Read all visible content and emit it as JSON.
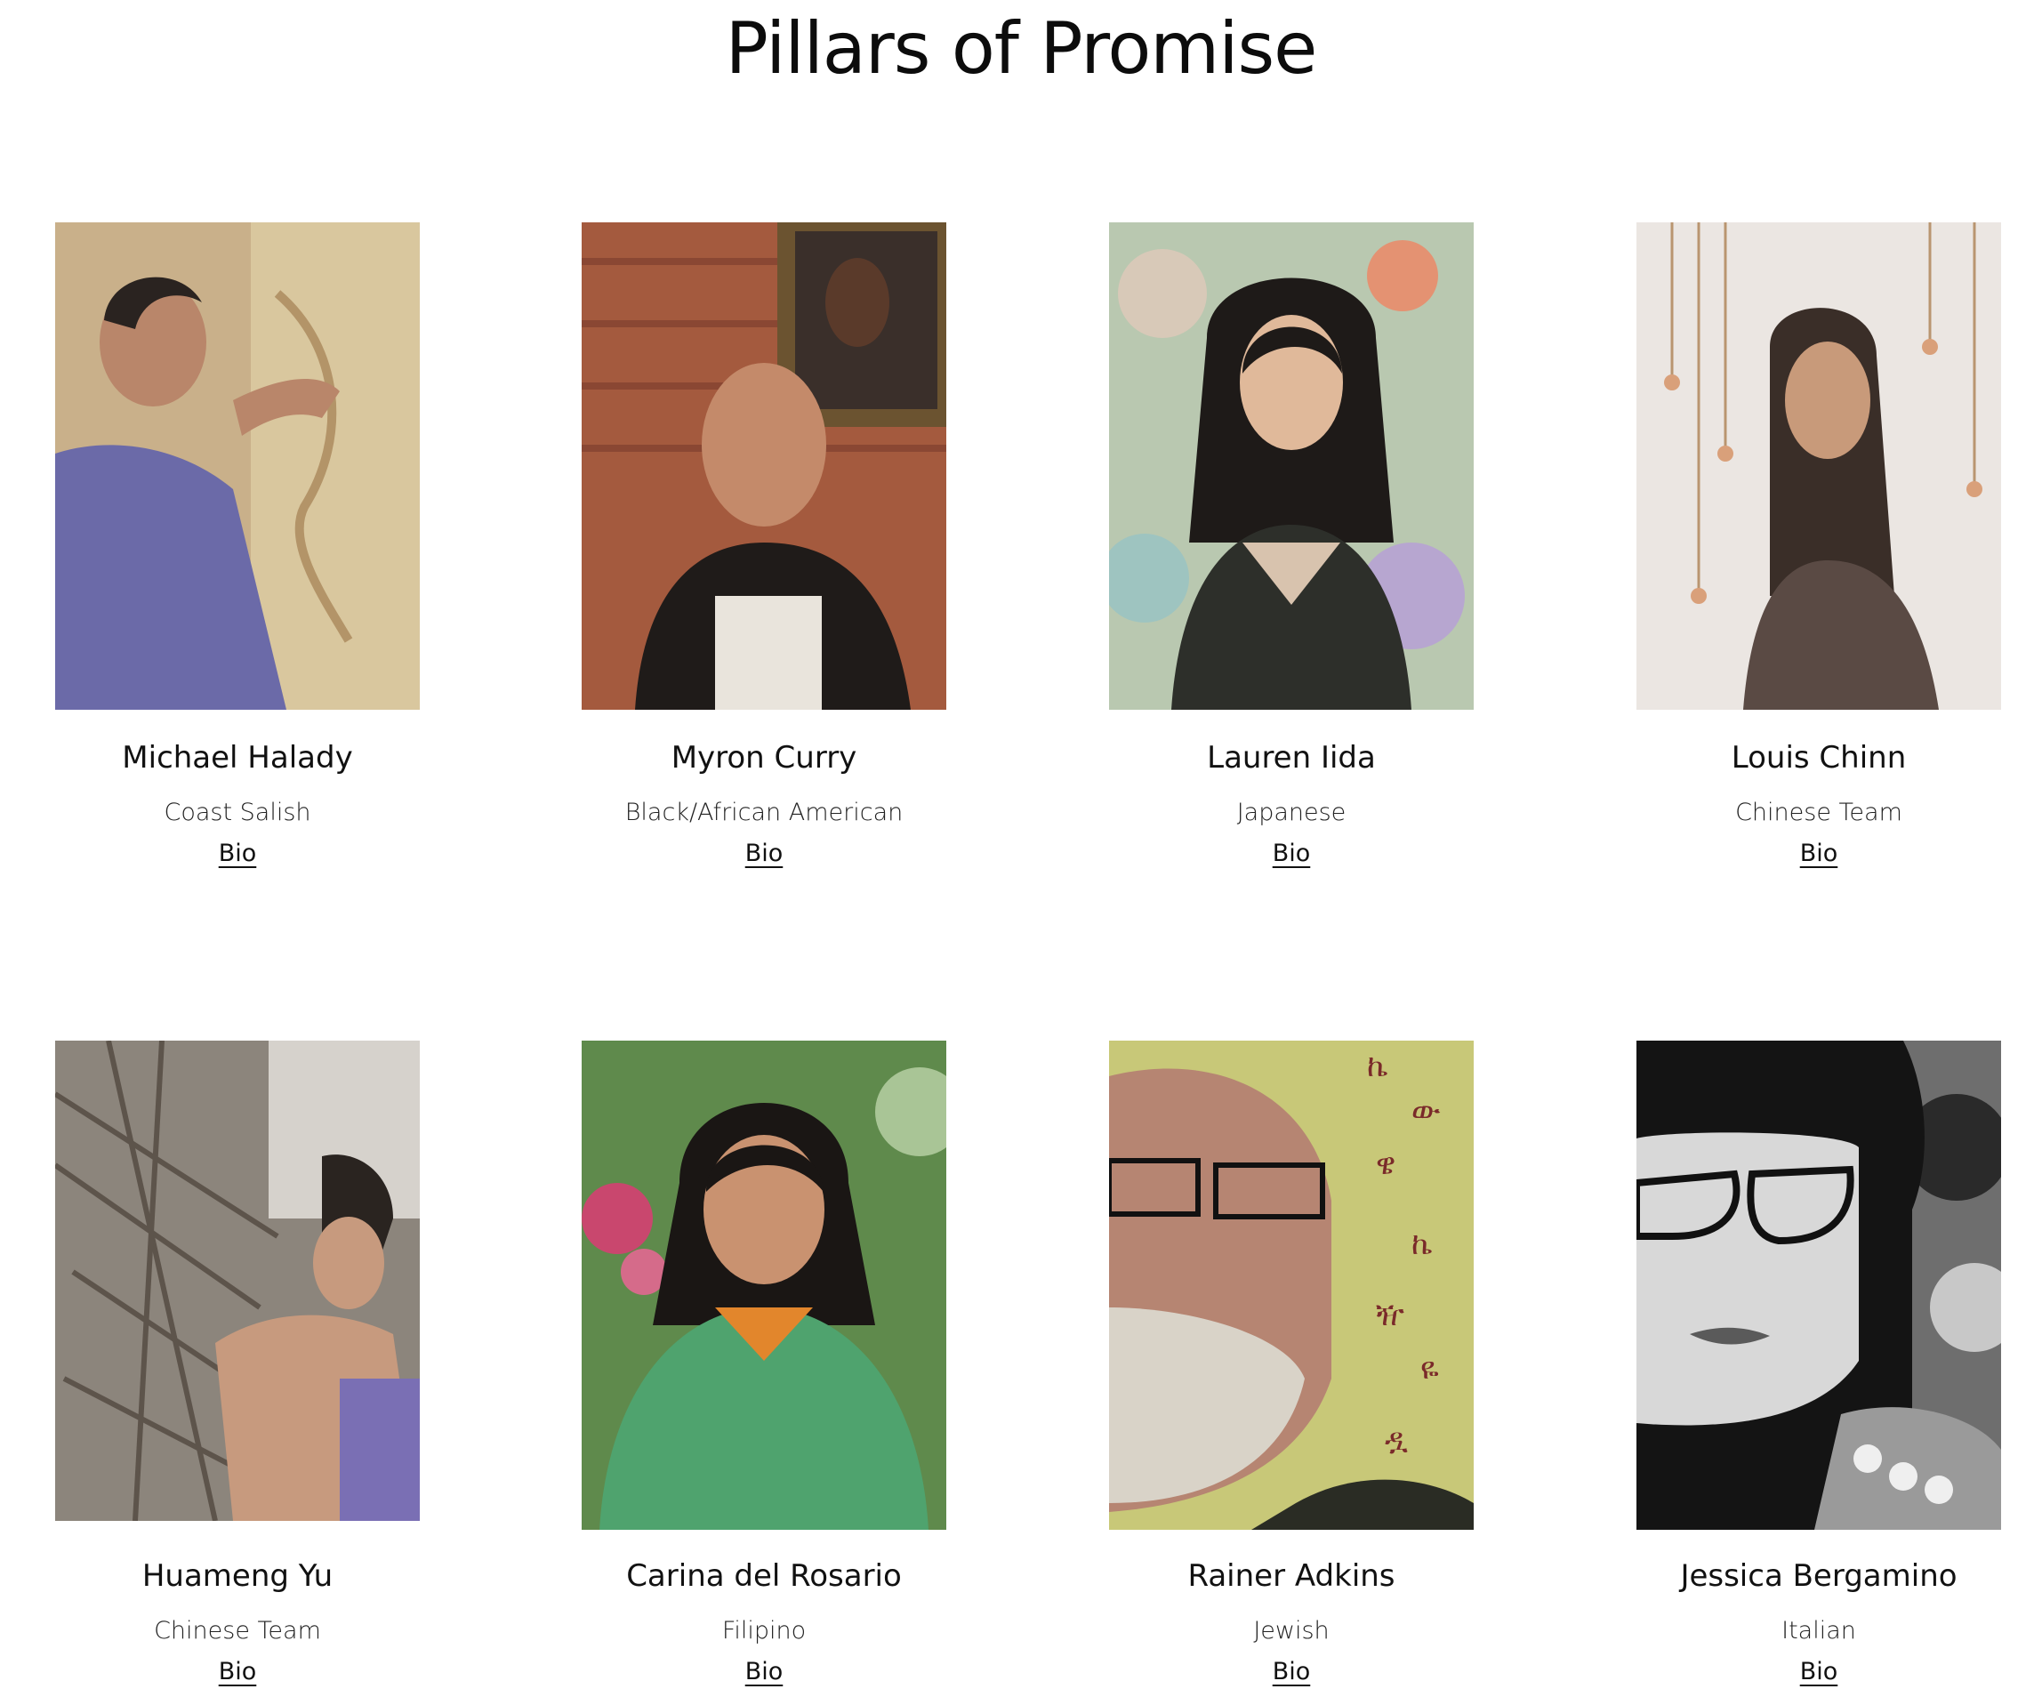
{
  "page": {
    "title": "Pillars of Promise"
  },
  "people": [
    {
      "name": "Michael Halady",
      "heritage": "Coast Salish",
      "bio_label": "Bio",
      "photo_colors": [
        "#c9b08a",
        "#6b6aa8",
        "#d9c79e"
      ]
    },
    {
      "name": "Myron Curry",
      "heritage": "Black/African American",
      "bio_label": "Bio",
      "photo_colors": [
        "#a45a3e",
        "#3a2b22",
        "#c48a6a"
      ]
    },
    {
      "name": "Lauren Iida",
      "heritage": "Japanese",
      "bio_label": "Bio",
      "photo_colors": [
        "#b9c8b0",
        "#2d2f2a",
        "#e0b99a"
      ]
    },
    {
      "name": "Louis Chinn",
      "heritage": "Chinese Team",
      "bio_label": "Bio",
      "photo_colors": [
        "#ebe6e2",
        "#5a4a44",
        "#c89a7a"
      ]
    },
    {
      "name": "Huameng Yu",
      "heritage": "Chinese Team",
      "bio_label": "Bio",
      "photo_colors": [
        "#8c857c",
        "#4a4038",
        "#c79a7e"
      ]
    },
    {
      "name": "Carina del Rosario",
      "heritage": "Filipino",
      "bio_label": "Bio",
      "photo_colors": [
        "#5f8a4c",
        "#4fa36e",
        "#c99270"
      ]
    },
    {
      "name": "Rainer Adkins",
      "heritage": "Jewish",
      "bio_label": "Bio",
      "photo_colors": [
        "#c8c878",
        "#2a2c24",
        "#b68572"
      ]
    },
    {
      "name": "Jessica Bergamino",
      "heritage": "Italian",
      "bio_label": "Bio",
      "photo_colors": [
        "#d8d8d8",
        "#141414",
        "#9a9a9a"
      ]
    }
  ]
}
